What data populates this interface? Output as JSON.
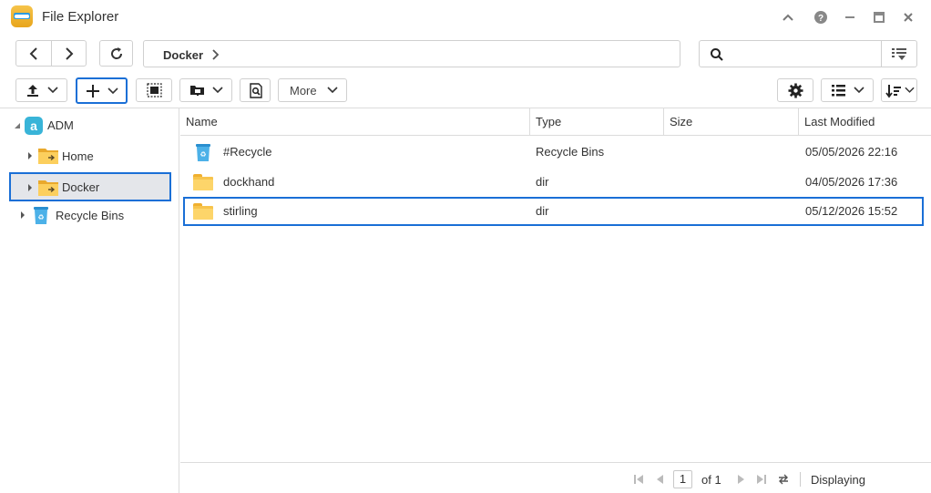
{
  "app": {
    "title": "File Explorer"
  },
  "address": {
    "crumbs": [
      "Docker"
    ]
  },
  "search": {
    "value": "",
    "placeholder": ""
  },
  "toolbar": {
    "more_label": "More"
  },
  "sidebar": {
    "root": "ADM",
    "items": [
      {
        "label": "Home",
        "icon": "shared-folder-icon"
      },
      {
        "label": "Docker",
        "icon": "shared-folder-icon",
        "selected": true
      },
      {
        "label": "Recycle Bins",
        "icon": "recycle-bin-icon"
      }
    ]
  },
  "table": {
    "columns": [
      "Name",
      "Type",
      "Size",
      "Last Modified"
    ],
    "rows": [
      {
        "name": "#Recycle",
        "type": "Recycle Bins",
        "size": "",
        "modified": "05/05/2026 22:16",
        "icon": "recycle-bin-icon"
      },
      {
        "name": "dockhand",
        "type": "dir",
        "size": "",
        "modified": "04/05/2026 17:36",
        "icon": "folder-icon"
      },
      {
        "name": "stirling",
        "type": "dir",
        "size": "",
        "modified": "05/12/2026 15:52",
        "icon": "folder-icon",
        "selected": true
      }
    ]
  },
  "pagination": {
    "page": "1",
    "of_label": "of 1",
    "status": "Displaying"
  },
  "colors": {
    "accent": "#1a6fd6",
    "folder": "#f7c44c",
    "recycle": "#3aa0dc"
  }
}
